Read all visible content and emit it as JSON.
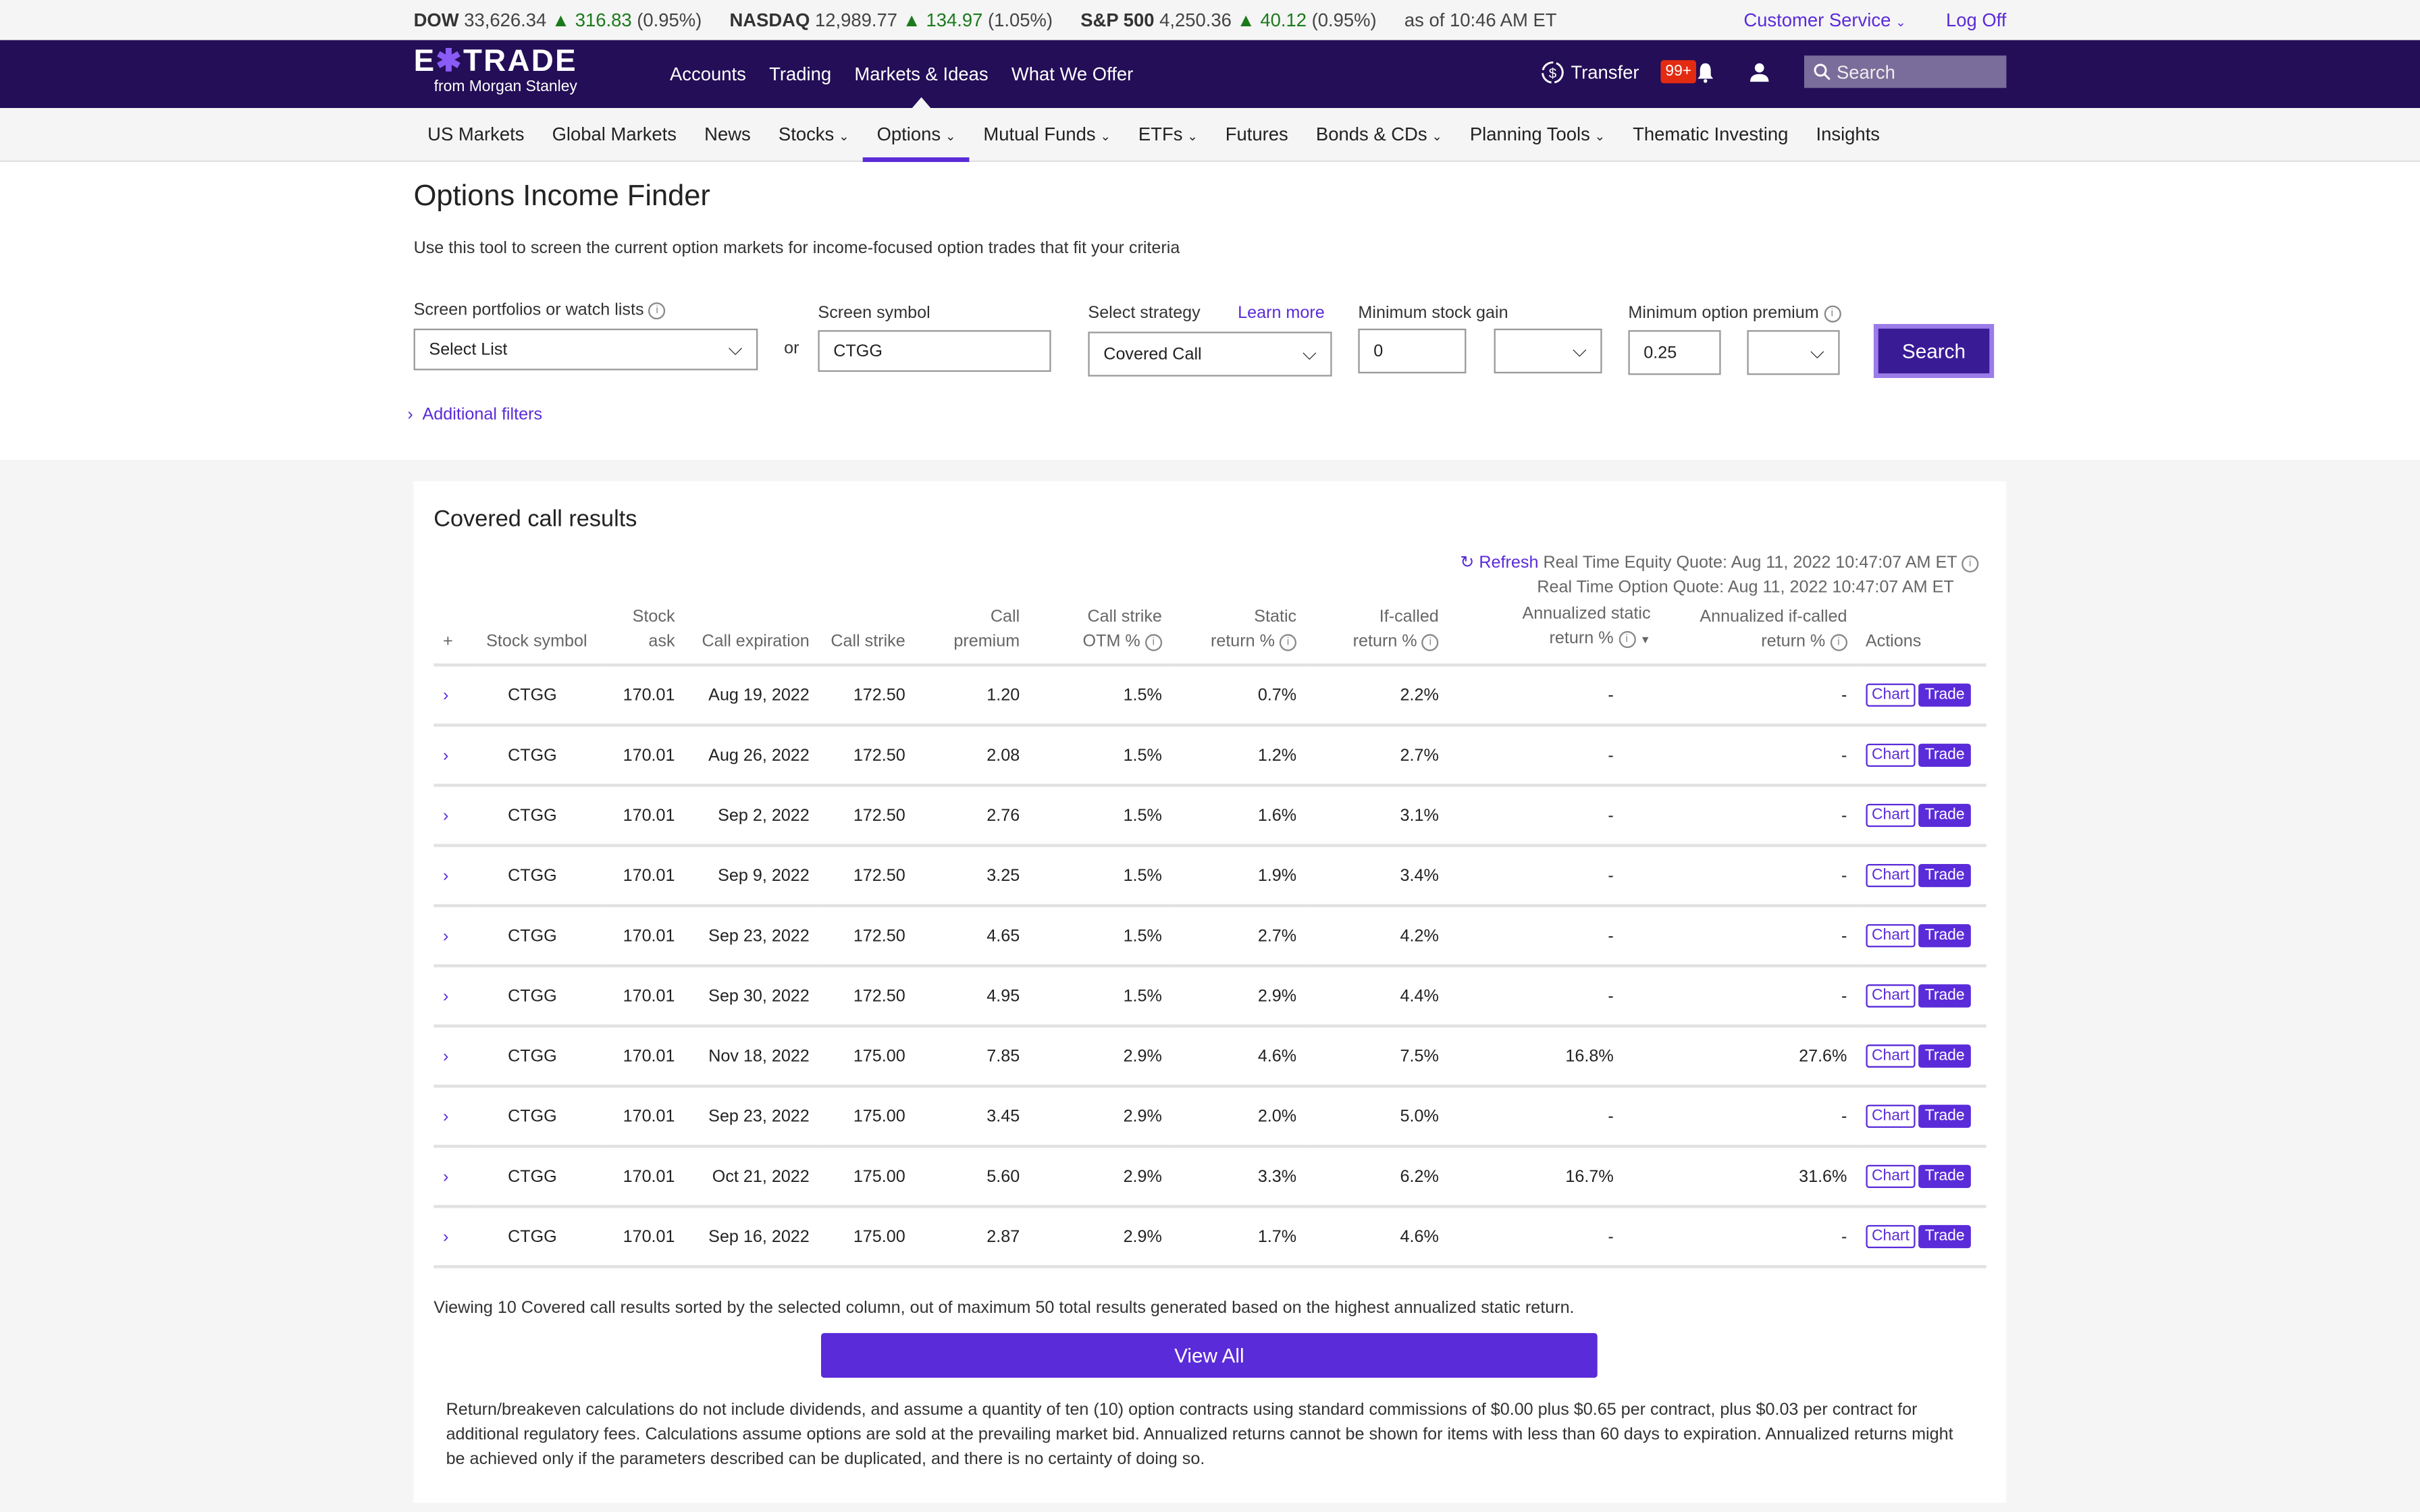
{
  "ticker": {
    "items": [
      {
        "name": "DOW",
        "value": "33,626.34",
        "change": "▲ 316.83",
        "pct": "(0.95%)"
      },
      {
        "name": "NASDAQ",
        "value": "12,989.77",
        "change": "▲ 134.97",
        "pct": "(1.05%)"
      },
      {
        "name": "S&P 500",
        "value": "4,250.36",
        "change": "▲ 40.12",
        "pct": "(0.95%)"
      }
    ],
    "as_of": "as of 10:46 AM ET",
    "customer_service": "Customer Service",
    "log_off": "Log Off"
  },
  "header": {
    "brand_e": "E",
    "brand_x": "✱",
    "brand_rest": "TRADE",
    "brand_sub": "from Morgan Stanley",
    "nav": [
      "Accounts",
      "Trading",
      "Markets & Ideas",
      "What We Offer"
    ],
    "transfer": "Transfer",
    "notifications": "99+",
    "search_placeholder": "Search"
  },
  "subnav": [
    {
      "label": "US Markets",
      "dropdown": false
    },
    {
      "label": "Global Markets",
      "dropdown": false
    },
    {
      "label": "News",
      "dropdown": false
    },
    {
      "label": "Stocks",
      "dropdown": true
    },
    {
      "label": "Options",
      "dropdown": true,
      "active": true
    },
    {
      "label": "Mutual Funds",
      "dropdown": true
    },
    {
      "label": "ETFs",
      "dropdown": true
    },
    {
      "label": "Futures",
      "dropdown": false
    },
    {
      "label": "Bonds & CDs",
      "dropdown": true
    },
    {
      "label": "Planning Tools",
      "dropdown": true
    },
    {
      "label": "Thematic Investing",
      "dropdown": false
    },
    {
      "label": "Insights",
      "dropdown": false
    }
  ],
  "page": {
    "title": "Options Income Finder",
    "description": "Use this tool to screen the current option markets for income-focused option trades that fit your criteria"
  },
  "form": {
    "portfolio_label": "Screen portfolios or watch lists",
    "portfolio_value": "Select List",
    "or": "or",
    "symbol_label": "Screen symbol",
    "symbol_value": "CTGG",
    "strategy_label": "Select strategy",
    "learn_more": "Learn more",
    "strategy_value": "Covered Call",
    "min_gain_label": "Minimum stock gain",
    "min_gain_value": "0",
    "min_gain_unit": "",
    "min_premium_label": "Minimum option premium",
    "min_premium_value": "0.25",
    "min_premium_unit": "",
    "search_button": "Search",
    "additional_filters": "Additional filters"
  },
  "results": {
    "title": "Covered call results",
    "refresh": "Refresh",
    "equity_quote": "Real Time Equity Quote: Aug 11, 2022 10:47:07 AM ET",
    "option_quote": "Real Time Option Quote: Aug 11, 2022 10:47:07 AM ET",
    "columns": {
      "expand": "+",
      "symbol": "Stock symbol",
      "ask": "Stock ask",
      "expiration": "Call expiration",
      "strike": "Call strike",
      "premium": "Call premium",
      "otm_1": "Call strike",
      "otm_2": "OTM %",
      "static_1": "Static",
      "static_2": "return %",
      "ifcalled_1": "If-called",
      "ifcalled_2": "return %",
      "ann_static_1": "Annualized static",
      "ann_static_2": "return %",
      "ann_ifcalled_1": "Annualized if-called",
      "ann_ifcalled_2": "return %",
      "actions": "Actions"
    },
    "rows": [
      {
        "symbol": "CTGG",
        "ask": "170.01",
        "expiration": "Aug 19, 2022",
        "strike": "172.50",
        "premium": "1.20",
        "otm": "1.5%",
        "static": "0.7%",
        "ifcalled": "2.2%",
        "ann_static": "-",
        "ann_ifcalled": "-"
      },
      {
        "symbol": "CTGG",
        "ask": "170.01",
        "expiration": "Aug 26, 2022",
        "strike": "172.50",
        "premium": "2.08",
        "otm": "1.5%",
        "static": "1.2%",
        "ifcalled": "2.7%",
        "ann_static": "-",
        "ann_ifcalled": "-"
      },
      {
        "symbol": "CTGG",
        "ask": "170.01",
        "expiration": "Sep 2, 2022",
        "strike": "172.50",
        "premium": "2.76",
        "otm": "1.5%",
        "static": "1.6%",
        "ifcalled": "3.1%",
        "ann_static": "-",
        "ann_ifcalled": "-"
      },
      {
        "symbol": "CTGG",
        "ask": "170.01",
        "expiration": "Sep 9, 2022",
        "strike": "172.50",
        "premium": "3.25",
        "otm": "1.5%",
        "static": "1.9%",
        "ifcalled": "3.4%",
        "ann_static": "-",
        "ann_ifcalled": "-"
      },
      {
        "symbol": "CTGG",
        "ask": "170.01",
        "expiration": "Sep 23, 2022",
        "strike": "172.50",
        "premium": "4.65",
        "otm": "1.5%",
        "static": "2.7%",
        "ifcalled": "4.2%",
        "ann_static": "-",
        "ann_ifcalled": "-"
      },
      {
        "symbol": "CTGG",
        "ask": "170.01",
        "expiration": "Sep 30, 2022",
        "strike": "172.50",
        "premium": "4.95",
        "otm": "1.5%",
        "static": "2.9%",
        "ifcalled": "4.4%",
        "ann_static": "-",
        "ann_ifcalled": "-"
      },
      {
        "symbol": "CTGG",
        "ask": "170.01",
        "expiration": "Nov 18, 2022",
        "strike": "175.00",
        "premium": "7.85",
        "otm": "2.9%",
        "static": "4.6%",
        "ifcalled": "7.5%",
        "ann_static": "16.8%",
        "ann_ifcalled": "27.6%"
      },
      {
        "symbol": "CTGG",
        "ask": "170.01",
        "expiration": "Sep 23, 2022",
        "strike": "175.00",
        "premium": "3.45",
        "otm": "2.9%",
        "static": "2.0%",
        "ifcalled": "5.0%",
        "ann_static": "-",
        "ann_ifcalled": "-"
      },
      {
        "symbol": "CTGG",
        "ask": "170.01",
        "expiration": "Oct 21, 2022",
        "strike": "175.00",
        "premium": "5.60",
        "otm": "2.9%",
        "static": "3.3%",
        "ifcalled": "6.2%",
        "ann_static": "16.7%",
        "ann_ifcalled": "31.6%"
      },
      {
        "symbol": "CTGG",
        "ask": "170.01",
        "expiration": "Sep 16, 2022",
        "strike": "175.00",
        "premium": "2.87",
        "otm": "2.9%",
        "static": "1.7%",
        "ifcalled": "4.6%",
        "ann_static": "-",
        "ann_ifcalled": "-"
      }
    ],
    "chart_label": "Chart",
    "trade_label": "Trade",
    "viewing_text": "Viewing 10 Covered call results sorted by the selected column, out of maximum 50 total results generated based on the highest annualized static return.",
    "view_all": "View All",
    "disclaimer": "Return/breakeven calculations do not include dividends, and assume a quantity of ten (10) option contracts using standard commissions of $0.00 plus $0.65 per contract, plus $0.03 per contract for additional regulatory fees. Calculations assume options are sold at the prevailing market bid. Annualized returns cannot be shown for items with less than 60 days to expiration. Annualized returns might be achieved only if the parameters described can be duplicated, and there is no certainty of doing so."
  }
}
